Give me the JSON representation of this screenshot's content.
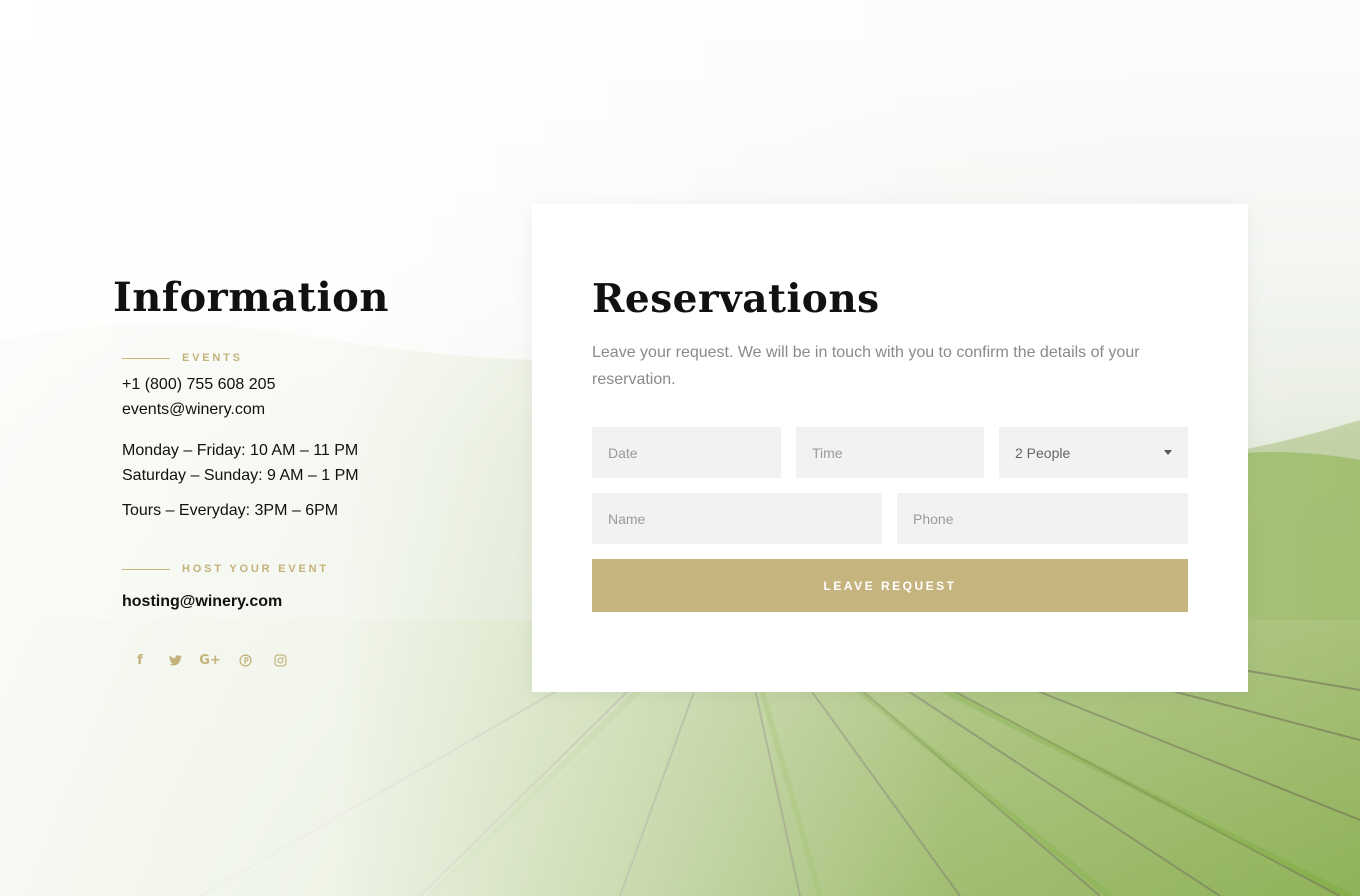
{
  "colors": {
    "accent": "#c6b47e",
    "label": "#c4b27b",
    "heading": "#111111",
    "muted_text": "#8a8a8a",
    "field_bg": "#f2f2f2"
  },
  "information": {
    "title": "Information",
    "events_label": "EVENTS",
    "phone": "+1 (800) 755 608 205",
    "email": "events@winery.com",
    "hours_weekdays": "Monday – Friday: 10 AM – 11 PM",
    "hours_weekend": "Saturday – Sunday: 9 AM – 1 PM",
    "tours": "Tours – Everyday: 3PM – 6PM",
    "host_label": "HOST YOUR EVENT",
    "host_email": "hosting@winery.com",
    "social": [
      {
        "icon": "facebook-icon",
        "glyph": "f"
      },
      {
        "icon": "twitter-icon",
        "glyph": "🐦"
      },
      {
        "icon": "google-plus-icon",
        "glyph": "G+"
      },
      {
        "icon": "pinterest-icon",
        "glyph": "℗"
      },
      {
        "icon": "instagram-icon",
        "glyph": "◎"
      }
    ]
  },
  "reservations": {
    "title": "Reservations",
    "description": "Leave your request. We will be in touch with you to confirm the details of your reservation.",
    "date_placeholder": "Date",
    "time_placeholder": "Time",
    "people_selected": "2 People",
    "name_placeholder": "Name",
    "phone_placeholder": "Phone",
    "submit_label": "LEAVE REQUEST"
  }
}
